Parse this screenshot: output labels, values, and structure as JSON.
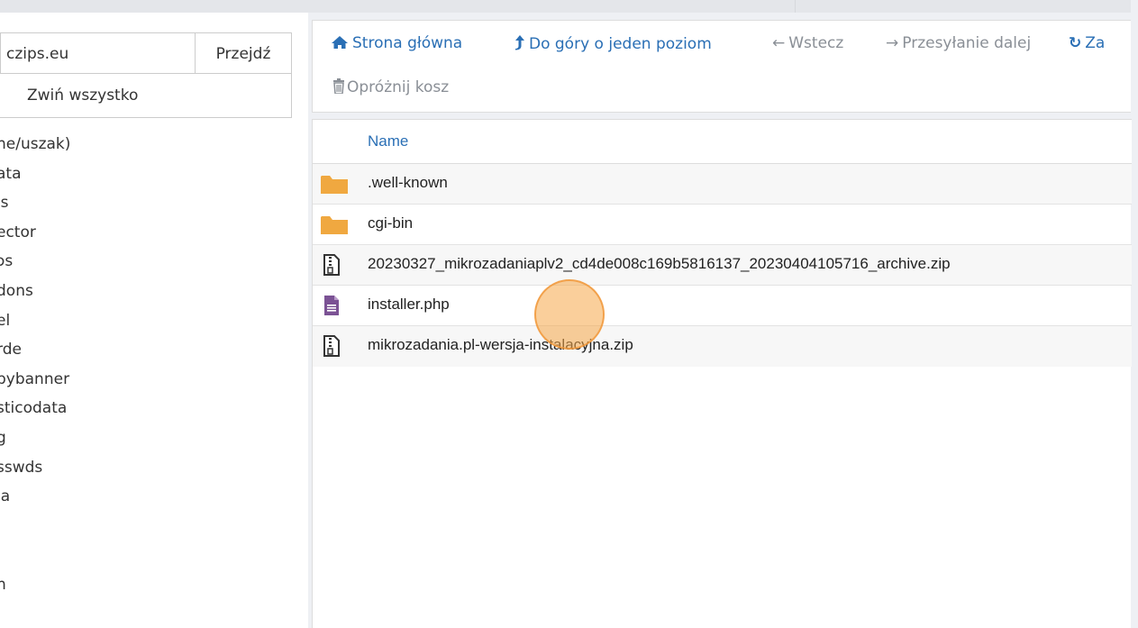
{
  "path_bar": {
    "value": "czips.eu",
    "go_label": "Przejdź"
  },
  "collapse_label": "Zwiń wszystko",
  "tree": [
    "ne/uszak)",
    "ata",
    "'s",
    "ector",
    "ɔs",
    "dons",
    "el",
    "rde",
    "pybanner",
    "sticodata",
    "g",
    "sswds",
    "la",
    "",
    "",
    "n"
  ],
  "toolbar": {
    "home": "Strona główna",
    "up": "Do góry o jeden poziom",
    "back": "Wstecz",
    "forward": "Przesyłanie dalej",
    "reload": "Za",
    "empty_trash": "Opróżnij kosz"
  },
  "table": {
    "header": "Name",
    "files": [
      {
        "name": ".well-known",
        "icon": "folder-icon"
      },
      {
        "name": "cgi-bin",
        "icon": "folder-icon"
      },
      {
        "name": "20230327_mikrozadaniaplv2_cd4de008c169b5816137_20230404105716_archive.zip",
        "icon": "zip-file-icon"
      },
      {
        "name": "installer.php",
        "icon": "php-file-icon"
      },
      {
        "name": "mikrozadania.pl-wersja-instalacyjna.zip",
        "icon": "zip-file-icon"
      }
    ]
  },
  "colors": {
    "accent": "#2a6fb5",
    "folder": "#f0a840",
    "php": "#7b5294",
    "cursor": "#f6a848"
  }
}
